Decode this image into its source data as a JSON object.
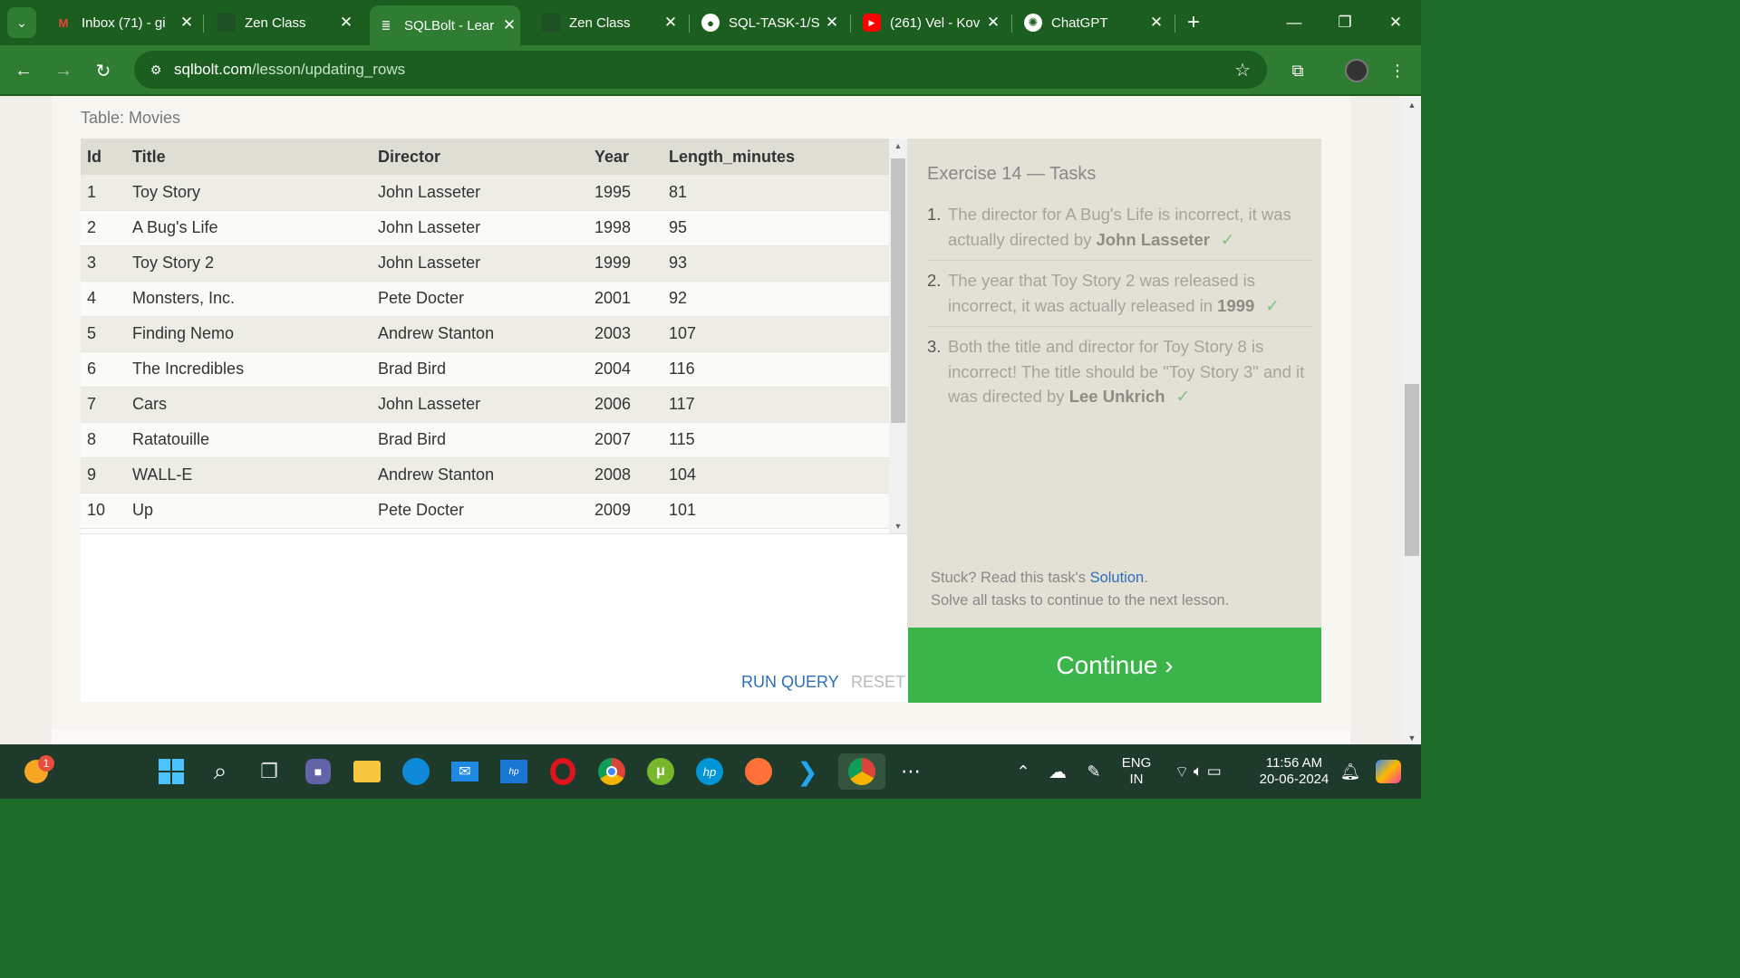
{
  "browser": {
    "tabs": [
      {
        "title": "Inbox (71) - gi",
        "icon": "gmail-icon",
        "active": false
      },
      {
        "title": "Zen Class",
        "icon": "zen-icon",
        "active": false
      },
      {
        "title": "SQLBolt - Lear",
        "icon": "database-icon",
        "active": true
      },
      {
        "title": "Zen Class",
        "icon": "zen-icon",
        "active": false
      },
      {
        "title": "SQL-TASK-1/S",
        "icon": "github-icon",
        "active": false
      },
      {
        "title": "(261) Vel - Kov",
        "icon": "youtube-icon",
        "active": false
      },
      {
        "title": "ChatGPT",
        "icon": "chatgpt-icon",
        "active": false
      }
    ],
    "url_domain": "sqlbolt.com",
    "url_path": "/lesson/updating_rows"
  },
  "table": {
    "caption": "Table: Movies",
    "columns": [
      "Id",
      "Title",
      "Director",
      "Year",
      "Length_minutes"
    ],
    "rows": [
      [
        "1",
        "Toy Story",
        "John Lasseter",
        "1995",
        "81"
      ],
      [
        "2",
        "A Bug's Life",
        "John Lasseter",
        "1998",
        "95"
      ],
      [
        "3",
        "Toy Story 2",
        "John Lasseter",
        "1999",
        "93"
      ],
      [
        "4",
        "Monsters, Inc.",
        "Pete Docter",
        "2001",
        "92"
      ],
      [
        "5",
        "Finding Nemo",
        "Andrew Stanton",
        "2003",
        "107"
      ],
      [
        "6",
        "The Incredibles",
        "Brad Bird",
        "2004",
        "116"
      ],
      [
        "7",
        "Cars",
        "John Lasseter",
        "2006",
        "117"
      ],
      [
        "8",
        "Ratatouille",
        "Brad Bird",
        "2007",
        "115"
      ],
      [
        "9",
        "WALL-E",
        "Andrew Stanton",
        "2008",
        "104"
      ],
      [
        "10",
        "Up",
        "Pete Docter",
        "2009",
        "101"
      ]
    ]
  },
  "editor": {
    "run_label": "RUN QUERY",
    "reset_label": "RESET"
  },
  "tasks": {
    "title": "Exercise 14 — Tasks",
    "items": [
      {
        "num": "1.",
        "text": "The director for A Bug's Life is incorrect, it was actually directed by ",
        "bold": "John Lasseter",
        "check": "✓"
      },
      {
        "num": "2.",
        "text": "The year that Toy Story 2 was released is incorrect, it was actually released in ",
        "bold": "1999",
        "check": "✓"
      },
      {
        "num": "3.",
        "text": "Both the title and director for Toy Story 8 is incorrect! The title should be \"Toy Story 3\" and it was directed by ",
        "bold": "Lee Unkrich",
        "check": "✓"
      }
    ],
    "stuck_prefix": "Stuck? Read this task's ",
    "solution_link": "Solution",
    "stuck_suffix": ".",
    "solve_note": "Solve all tasks to continue to the next lesson.",
    "continue_label": "Continue ›"
  },
  "taskbar": {
    "notification_count": "1",
    "lang_top": "ENG",
    "lang_bottom": "IN",
    "time": "11:56 AM",
    "date": "20-06-2024"
  },
  "colors": {
    "chrome_theme": "#2e7d32",
    "continue_button": "#3bb54a",
    "link": "#2c6fb8"
  }
}
